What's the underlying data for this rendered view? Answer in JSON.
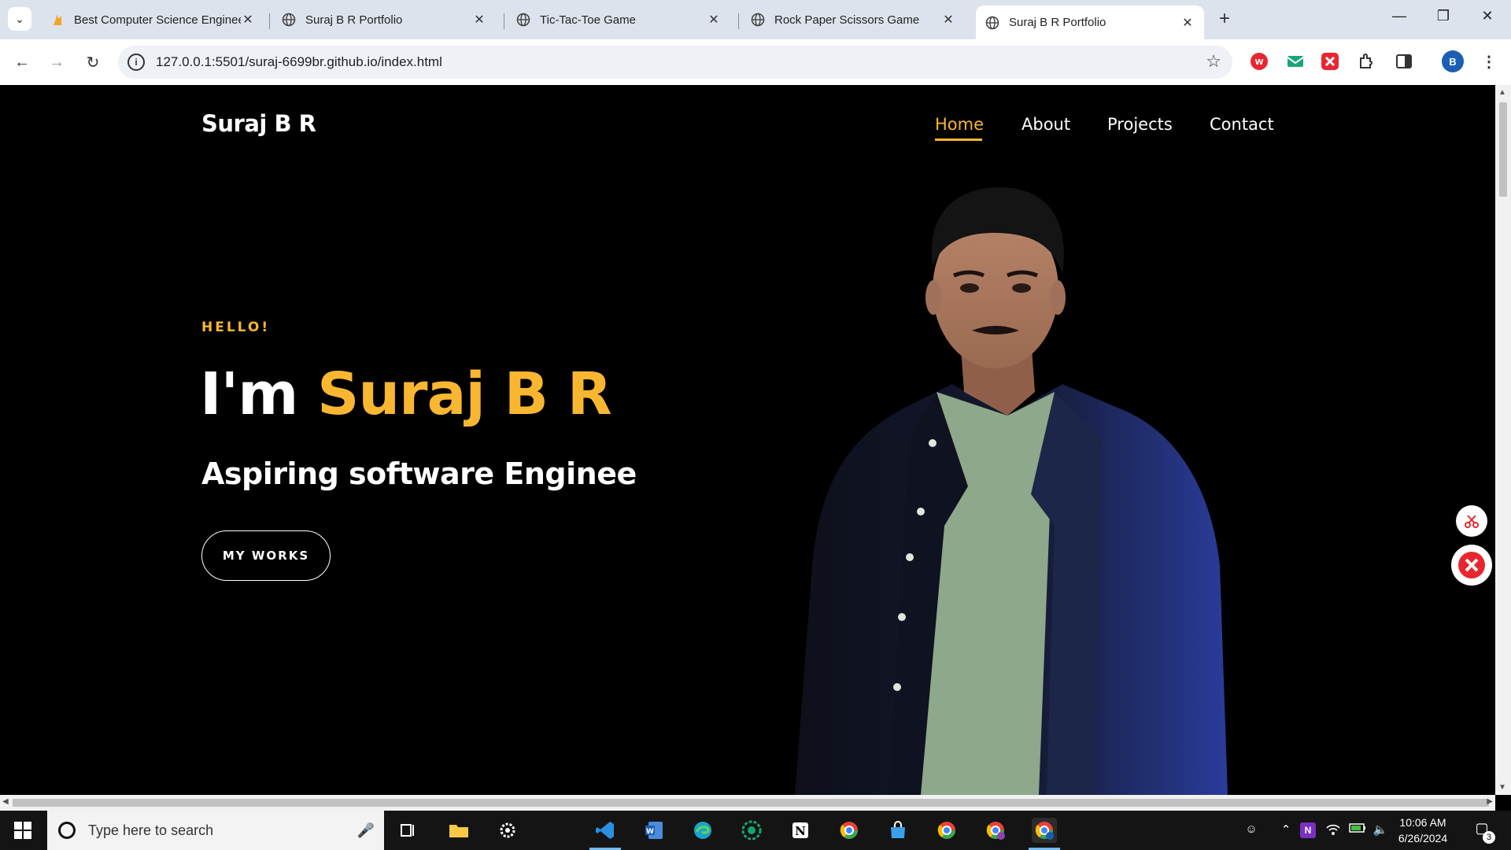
{
  "browser": {
    "tabs": [
      {
        "title": "Best Computer Science Enginee",
        "active": false,
        "favicon": "flame-favicon"
      },
      {
        "title": "Suraj B R Portfolio",
        "active": false,
        "favicon": "globe-icon"
      },
      {
        "title": "Tic-Tac-Toe Game",
        "active": false,
        "favicon": "globe-icon"
      },
      {
        "title": "Rock Paper Scissors Game",
        "active": false,
        "favicon": "globe-icon"
      },
      {
        "title": "Suraj B R Portfolio",
        "active": true,
        "favicon": "globe-icon"
      }
    ],
    "new_tab": "+",
    "url": "127.0.0.1:5501/suraj-6699br.github.io/index.html",
    "profile_initial": "B",
    "extensions": [
      "wps-extension-icon",
      "mail-extension-icon",
      "xmind-extension-icon",
      "puzzle-extensions-icon"
    ]
  },
  "site": {
    "logo": "Suraj B R",
    "nav": [
      {
        "label": "Home",
        "active": true
      },
      {
        "label": "About",
        "active": false
      },
      {
        "label": "Projects",
        "active": false
      },
      {
        "label": "Contact",
        "active": false
      }
    ],
    "hero": {
      "greeting": "HELLO!",
      "headline_prefix": "I'm ",
      "headline_name": "Suraj B R",
      "subtitle": "Aspiring software Enginee",
      "cta": "MY WORKS"
    },
    "accent_color": "#f9b631"
  },
  "taskbar": {
    "search_placeholder": "Type here to search",
    "time": "10:06 AM",
    "date": "6/26/2024",
    "notification_count": "3"
  }
}
